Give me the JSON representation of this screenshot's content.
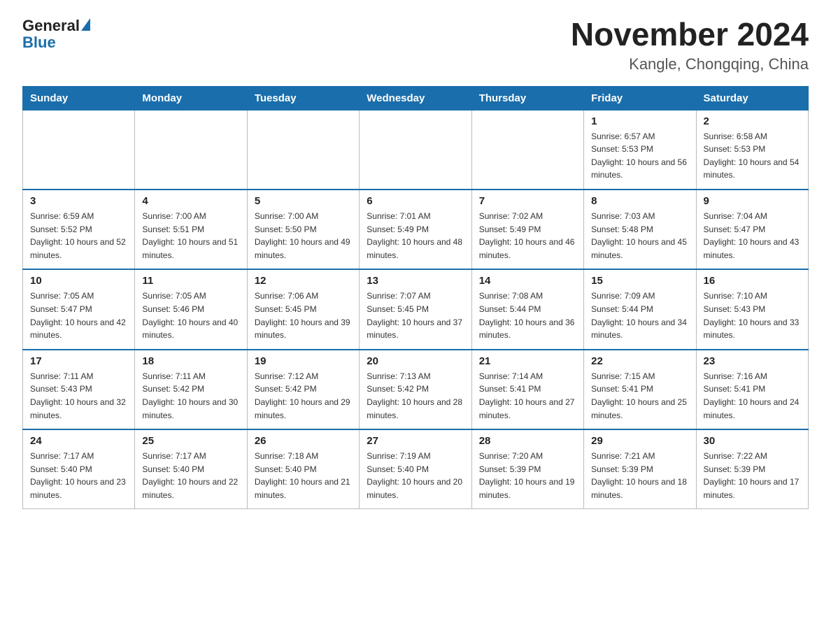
{
  "logo": {
    "general": "General",
    "blue": "Blue"
  },
  "title": "November 2024",
  "subtitle": "Kangle, Chongqing, China",
  "days_of_week": [
    "Sunday",
    "Monday",
    "Tuesday",
    "Wednesday",
    "Thursday",
    "Friday",
    "Saturday"
  ],
  "weeks": [
    [
      {
        "day": "",
        "info": ""
      },
      {
        "day": "",
        "info": ""
      },
      {
        "day": "",
        "info": ""
      },
      {
        "day": "",
        "info": ""
      },
      {
        "day": "",
        "info": ""
      },
      {
        "day": "1",
        "info": "Sunrise: 6:57 AM\nSunset: 5:53 PM\nDaylight: 10 hours and 56 minutes."
      },
      {
        "day": "2",
        "info": "Sunrise: 6:58 AM\nSunset: 5:53 PM\nDaylight: 10 hours and 54 minutes."
      }
    ],
    [
      {
        "day": "3",
        "info": "Sunrise: 6:59 AM\nSunset: 5:52 PM\nDaylight: 10 hours and 52 minutes."
      },
      {
        "day": "4",
        "info": "Sunrise: 7:00 AM\nSunset: 5:51 PM\nDaylight: 10 hours and 51 minutes."
      },
      {
        "day": "5",
        "info": "Sunrise: 7:00 AM\nSunset: 5:50 PM\nDaylight: 10 hours and 49 minutes."
      },
      {
        "day": "6",
        "info": "Sunrise: 7:01 AM\nSunset: 5:49 PM\nDaylight: 10 hours and 48 minutes."
      },
      {
        "day": "7",
        "info": "Sunrise: 7:02 AM\nSunset: 5:49 PM\nDaylight: 10 hours and 46 minutes."
      },
      {
        "day": "8",
        "info": "Sunrise: 7:03 AM\nSunset: 5:48 PM\nDaylight: 10 hours and 45 minutes."
      },
      {
        "day": "9",
        "info": "Sunrise: 7:04 AM\nSunset: 5:47 PM\nDaylight: 10 hours and 43 minutes."
      }
    ],
    [
      {
        "day": "10",
        "info": "Sunrise: 7:05 AM\nSunset: 5:47 PM\nDaylight: 10 hours and 42 minutes."
      },
      {
        "day": "11",
        "info": "Sunrise: 7:05 AM\nSunset: 5:46 PM\nDaylight: 10 hours and 40 minutes."
      },
      {
        "day": "12",
        "info": "Sunrise: 7:06 AM\nSunset: 5:45 PM\nDaylight: 10 hours and 39 minutes."
      },
      {
        "day": "13",
        "info": "Sunrise: 7:07 AM\nSunset: 5:45 PM\nDaylight: 10 hours and 37 minutes."
      },
      {
        "day": "14",
        "info": "Sunrise: 7:08 AM\nSunset: 5:44 PM\nDaylight: 10 hours and 36 minutes."
      },
      {
        "day": "15",
        "info": "Sunrise: 7:09 AM\nSunset: 5:44 PM\nDaylight: 10 hours and 34 minutes."
      },
      {
        "day": "16",
        "info": "Sunrise: 7:10 AM\nSunset: 5:43 PM\nDaylight: 10 hours and 33 minutes."
      }
    ],
    [
      {
        "day": "17",
        "info": "Sunrise: 7:11 AM\nSunset: 5:43 PM\nDaylight: 10 hours and 32 minutes."
      },
      {
        "day": "18",
        "info": "Sunrise: 7:11 AM\nSunset: 5:42 PM\nDaylight: 10 hours and 30 minutes."
      },
      {
        "day": "19",
        "info": "Sunrise: 7:12 AM\nSunset: 5:42 PM\nDaylight: 10 hours and 29 minutes."
      },
      {
        "day": "20",
        "info": "Sunrise: 7:13 AM\nSunset: 5:42 PM\nDaylight: 10 hours and 28 minutes."
      },
      {
        "day": "21",
        "info": "Sunrise: 7:14 AM\nSunset: 5:41 PM\nDaylight: 10 hours and 27 minutes."
      },
      {
        "day": "22",
        "info": "Sunrise: 7:15 AM\nSunset: 5:41 PM\nDaylight: 10 hours and 25 minutes."
      },
      {
        "day": "23",
        "info": "Sunrise: 7:16 AM\nSunset: 5:41 PM\nDaylight: 10 hours and 24 minutes."
      }
    ],
    [
      {
        "day": "24",
        "info": "Sunrise: 7:17 AM\nSunset: 5:40 PM\nDaylight: 10 hours and 23 minutes."
      },
      {
        "day": "25",
        "info": "Sunrise: 7:17 AM\nSunset: 5:40 PM\nDaylight: 10 hours and 22 minutes."
      },
      {
        "day": "26",
        "info": "Sunrise: 7:18 AM\nSunset: 5:40 PM\nDaylight: 10 hours and 21 minutes."
      },
      {
        "day": "27",
        "info": "Sunrise: 7:19 AM\nSunset: 5:40 PM\nDaylight: 10 hours and 20 minutes."
      },
      {
        "day": "28",
        "info": "Sunrise: 7:20 AM\nSunset: 5:39 PM\nDaylight: 10 hours and 19 minutes."
      },
      {
        "day": "29",
        "info": "Sunrise: 7:21 AM\nSunset: 5:39 PM\nDaylight: 10 hours and 18 minutes."
      },
      {
        "day": "30",
        "info": "Sunrise: 7:22 AM\nSunset: 5:39 PM\nDaylight: 10 hours and 17 minutes."
      }
    ]
  ]
}
